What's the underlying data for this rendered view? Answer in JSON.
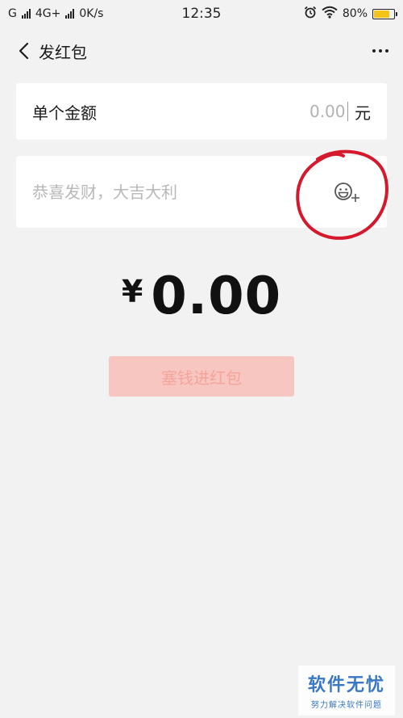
{
  "status_bar": {
    "carrier_1": "G",
    "carrier_2": "4G+",
    "speed": "0K/s",
    "time": "12:35",
    "battery_percent": "80%",
    "battery_level": 0.8,
    "icons": [
      "signal-icon",
      "alarm-icon",
      "wifi-icon",
      "battery-icon"
    ]
  },
  "nav": {
    "title": "发红包",
    "back_icon": "chevron-left-icon",
    "more_icon": "more-dots-icon"
  },
  "amount_card": {
    "label": "单个金额",
    "placeholder": "0.00",
    "unit": "元"
  },
  "greeting_card": {
    "placeholder": "恭喜发财，大吉大利",
    "emoji_icon": "emoji-add-icon"
  },
  "total": {
    "currency": "¥",
    "value": "0.00"
  },
  "submit": {
    "label": "塞钱进红包"
  },
  "watermark": {
    "title": "软件无忧",
    "subtitle": "努力解决软件问题"
  },
  "colors": {
    "background": "#f2f2f2",
    "card": "#ffffff",
    "button_disabled_bg": "#f8c6c0",
    "button_disabled_text": "#f4a49b",
    "annotation": "#d6182c",
    "watermark": "#3a78c4"
  }
}
